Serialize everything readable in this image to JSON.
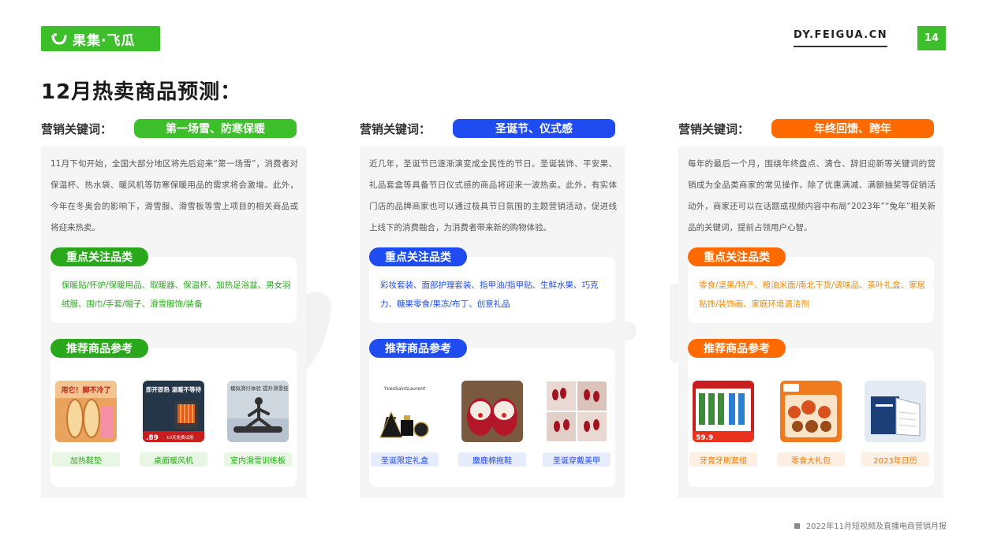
{
  "header": {
    "logo_text": "果集·飞瓜",
    "site": "DY.FEIGUA.CN",
    "page_number": "14"
  },
  "title": "12月热卖商品预测：",
  "colors": {
    "green": "#3cbf2a",
    "blue": "#1f4cf0",
    "orange": "#ff6a00"
  },
  "columns": [
    {
      "accent": "#3cbf2a",
      "keyword_label": "营销关键词：",
      "keyword": "第一场雪、防寒保暖",
      "intro": "11月下旬开始，全国大部分地区将先后迎来“第一场雪”，消费者对保温杯、热水袋、暖风机等防寒保暖用品的需求将会激增。此外，今年在冬奥会的影响下，滑雪服、滑雪板等雪上项目的相关商品或将迎来热卖。",
      "focus_title": "重点关注品类",
      "focus_text": "保暖贴/怀炉/保暖用品、取暖器、保温杯、加热足浴盆、男女羽绒服、围巾/手套/帽子、滑雪服饰/装备",
      "focus_color": "#2aa81c",
      "rec_title": "推荐商品参考",
      "label_bg": "#e8f7e3",
      "label_color": "#2aa81c",
      "products": [
        {
          "label": "加热鞋垫",
          "img_text": "用它！脚不冷了",
          "icon": "heated-insole-icon"
        },
        {
          "label": "桌面暖风机",
          "img_text": "即开即热 温暖不等待",
          "img_text2": "10天免费试用",
          "img_num": ".89",
          "icon": "desk-heater-icon"
        },
        {
          "label": "室内滑雪训练板",
          "img_text": "模拟滑行体验 提升滑雪技能",
          "icon": "ski-board-icon"
        }
      ]
    },
    {
      "accent": "#1f4cf0",
      "keyword_label": "营销关键词：",
      "keyword": "圣诞节、仪式感",
      "intro": "近几年，圣诞节已逐渐演变成全民性的节日。圣诞装饰、平安果、礼品套盒等具备节日仪式感的商品将迎来一波热卖。此外，有实体门店的品牌商家也可以通过极具节日氛围的主题营销活动，促进线上线下的消费融合，为消费者带来新的购物体验。",
      "focus_title": "重点关注品类",
      "focus_text": "彩妆套装、面部护理套装、指甲油/指甲贴、生鲜水果、巧克力、糖果零食/果冻/布丁、创意礼品",
      "focus_color": "#1f4cf0",
      "rec_title": "推荐商品参考",
      "label_bg": "#e6ecfc",
      "label_color": "#1f4cf0",
      "products": [
        {
          "label": "圣诞限定礼盒",
          "img_text": "YvesSaintLaurent",
          "icon": "makeup-gift-box-icon"
        },
        {
          "label": "麋鹿棉拖鞋",
          "icon": "reindeer-slippers-icon"
        },
        {
          "label": "圣诞穿戴美甲",
          "icon": "press-on-nails-icon"
        }
      ]
    },
    {
      "accent": "#ff6a00",
      "keyword_label": "营销关键词：",
      "keyword": "年终回馈、跨年",
      "intro": "每年的最后一个月，围绕年终盘点、清仓、辞旧迎新等关键词的营销成为全品类商家的常见操作，除了优惠满减、满额抽奖等促销活动外，商家还可以在话题或视频内容中布局“2023年”“兔年”相关新品的关键词，提前占领用户心智。",
      "focus_title": "重点关注品类",
      "focus_text": "零食/坚果/特产、粮油米面/南北干货/调味品、茶叶礼盒、家居贴饰/装饰画、家庭环境清洁剂",
      "focus_color": "#f08a00",
      "rec_title": "推荐商品参考",
      "label_bg": "#fdf0e3",
      "label_color": "#f07a00",
      "products": [
        {
          "label": "牙膏牙刷套组",
          "img_text": "59.9",
          "icon": "toothpaste-set-icon"
        },
        {
          "label": "零食大礼包",
          "icon": "snack-gift-pack-icon"
        },
        {
          "label": "2023年日历",
          "icon": "desk-calendar-icon"
        }
      ]
    }
  ],
  "footer": "2022年11月短视频及直播电商营销月报"
}
